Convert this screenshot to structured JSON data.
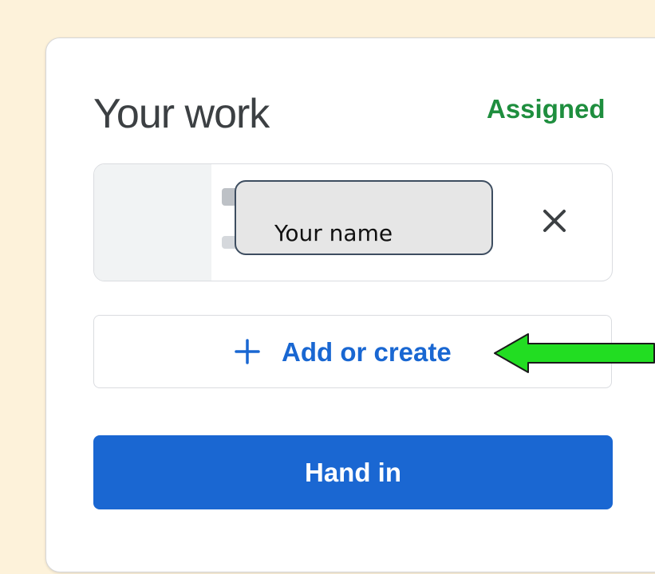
{
  "card": {
    "title": "Your work",
    "status": "Assigned"
  },
  "attachment": {
    "overlay_label": "Your name",
    "remove_icon": "close-icon"
  },
  "actions": {
    "add_label": "Add or create",
    "add_icon": "plus-icon",
    "hand_in_label": "Hand in"
  },
  "annotation": {
    "icon": "arrow-left-icon",
    "color": "#22dd22"
  },
  "colors": {
    "page_background": "#fdf2da",
    "status_green": "#1e8e3e",
    "link_blue": "#1967d2",
    "primary_blue": "#1a67d2"
  }
}
